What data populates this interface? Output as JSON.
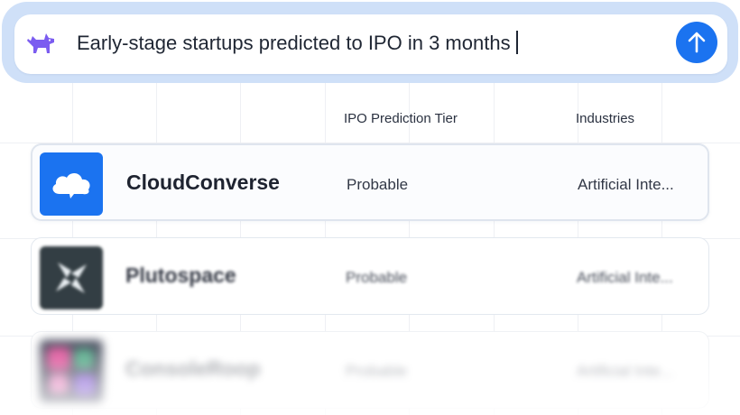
{
  "search": {
    "query": "Early-stage startups predicted to IPO in 3 months",
    "submit_icon": "arrow-up-icon",
    "brand_icon": "dog-icon"
  },
  "columns": {
    "tier": "IPO Prediction Tier",
    "industries": "Industries"
  },
  "rows": [
    {
      "name": "CloudConverse",
      "tier": "Probable",
      "industry": "Artificial Inte...",
      "logo_icon": "cloud-icon",
      "logo_color": "#1b73f0"
    },
    {
      "name": "Plutospace",
      "tier": "Probable",
      "industry": "Artificial Inte...",
      "logo_icon": "pinwheel-icon",
      "logo_color": "#1e2a30"
    },
    {
      "name": "ConsoleRoop",
      "tier": "Probable",
      "industry": "Artificial Inte...",
      "logo_icon": "app-tile-icon",
      "logo_color": "#3a3f52"
    }
  ],
  "colors": {
    "accent": "#1b73f0",
    "search_frame": "#cfe0f8",
    "brand_purple": "#7b5cf0"
  }
}
